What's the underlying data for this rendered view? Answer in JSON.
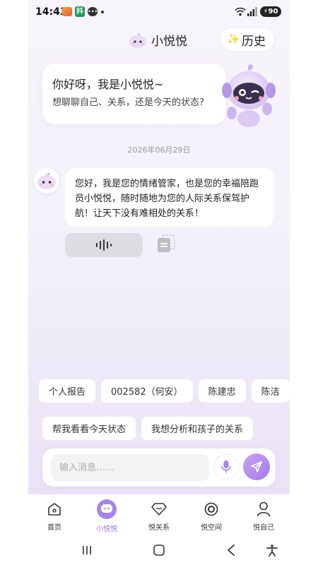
{
  "status_bar": {
    "time": "14:43",
    "battery": "90"
  },
  "header": {
    "title": "小悦悦",
    "history_label": "历史"
  },
  "greeting": {
    "line1": "你好呀，我是小悦悦~",
    "line2": "想聊聊自己、关系，还是今天的状态?"
  },
  "chat": {
    "date": "2026年06月29日",
    "message": "您好，我是您的情绪管家，也是您的幸福陪跑员小悦悦，随时随地为您的人际关系保驾护航！让天下没有难相处的关系！"
  },
  "quick_chips_row1": [
    "个人报告",
    "002582（何安）",
    "陈建忠",
    "陈洁"
  ],
  "quick_chips_row2": [
    "帮我看看今天状态",
    "我想分析和孩子的关系"
  ],
  "input": {
    "placeholder": "输入消息......"
  },
  "tabs": [
    {
      "label": "首页",
      "icon": "home-icon"
    },
    {
      "label": "小悦悦",
      "icon": "chat-bubble-icon"
    },
    {
      "label": "悦关系",
      "icon": "diamond-icon"
    },
    {
      "label": "悦空间",
      "icon": "target-icon"
    },
    {
      "label": "悦自己",
      "icon": "person-icon"
    }
  ],
  "colors": {
    "accent": "#a884e6",
    "active_tab_text": "#9a78d8",
    "send_button": "#b48ff0"
  }
}
